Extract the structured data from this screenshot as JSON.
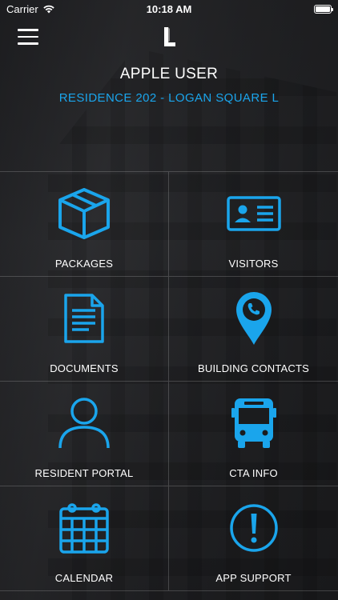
{
  "status_bar": {
    "carrier": "Carrier",
    "time": "10:18 AM"
  },
  "header": {
    "user_name": "APPLE USER",
    "residence": "RESIDENCE 202 - LOGAN SQUARE L"
  },
  "colors": {
    "accent": "#1aa5ec",
    "background": "#1b1c1e"
  },
  "tiles": [
    {
      "label": "PACKAGES",
      "icon": "package-icon"
    },
    {
      "label": "VISITORS",
      "icon": "id-card-icon"
    },
    {
      "label": "DOCUMENTS",
      "icon": "document-icon"
    },
    {
      "label": "BUILDING CONTACTS",
      "icon": "phone-pin-icon"
    },
    {
      "label": "RESIDENT PORTAL",
      "icon": "person-icon"
    },
    {
      "label": "CTA INFO",
      "icon": "bus-icon"
    },
    {
      "label": "CALENDAR",
      "icon": "calendar-icon"
    },
    {
      "label": "APP SUPPORT",
      "icon": "alert-icon"
    }
  ]
}
